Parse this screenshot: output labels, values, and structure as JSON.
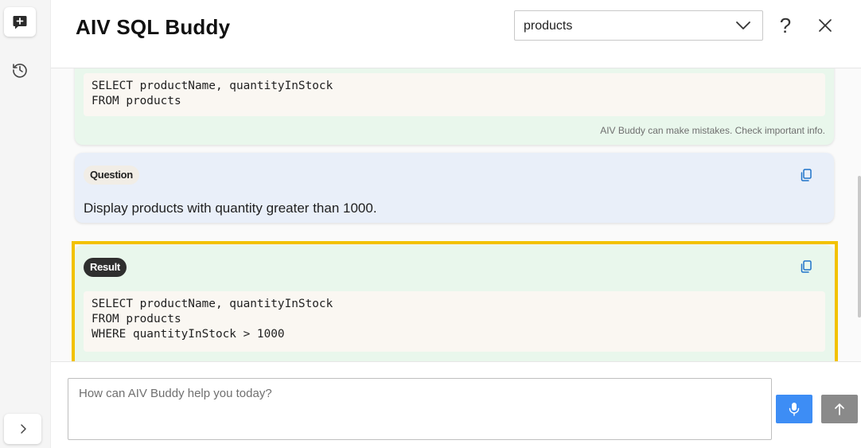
{
  "app": {
    "title": "AIV SQL Buddy"
  },
  "header": {
    "table_select_value": "products",
    "help_label": "?"
  },
  "rail": {
    "icons": [
      "new-chat-icon",
      "history-icon",
      "chevron-right-icon"
    ]
  },
  "chat": {
    "previous_result": {
      "code_lines": [
        "SELECT productName, quantityInStock",
        "FROM products"
      ],
      "disclaimer": "AIV Buddy can make mistakes. Check important info."
    },
    "question": {
      "badge": "Question",
      "text": "Display products with quantity greater than 1000."
    },
    "result": {
      "badge": "Result",
      "code_lines": [
        "SELECT productName, quantityInStock",
        "FROM products",
        "WHERE quantityInStock > 1000"
      ]
    }
  },
  "input": {
    "placeholder": "How can AIV Buddy help you today?",
    "value": ""
  },
  "colors": {
    "result_card": "#e9f7ec",
    "question_card": "#e9eff9",
    "mic_button": "#3d8df5",
    "send_button": "#8a8a8a",
    "highlight": "#f2c200"
  }
}
